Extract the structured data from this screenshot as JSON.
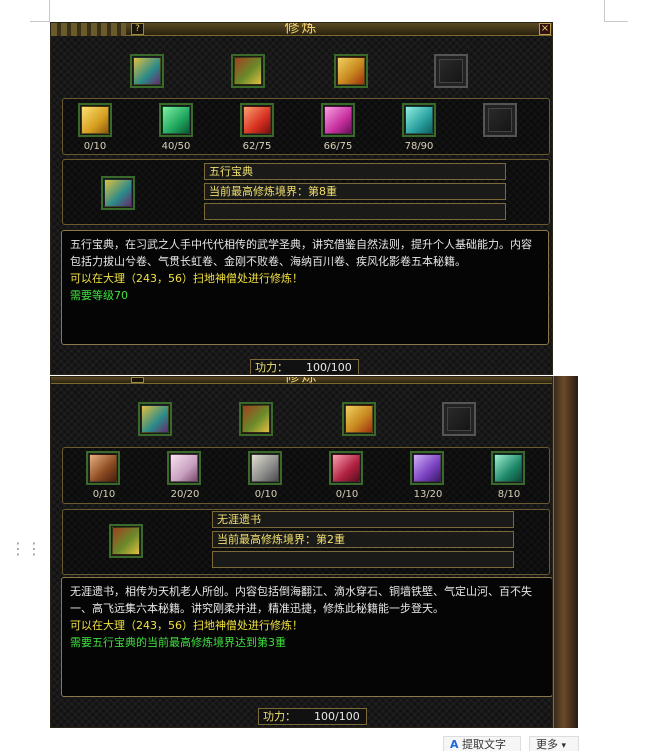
{
  "toolbar": {
    "extract_text_label": "提取文字",
    "more_label": "更多",
    "extract_icon": "text-extract-icon",
    "more_icon": "chevron-down-icon"
  },
  "panel1": {
    "title": "修炼",
    "help": "?",
    "close": "×",
    "top_books": [
      {
        "icon": "wuxing-book-icon",
        "color": "#2a8a8a"
      },
      {
        "icon": "wuya-book-icon",
        "color": "#6a8a2a"
      },
      {
        "icon": "gold-book-icon",
        "color": "#c88a20"
      },
      {
        "icon": "empty-slot-icon",
        "color": "#333333"
      }
    ],
    "sub_books": [
      {
        "icon": "gold-scroll-icon",
        "color": "#d8a020",
        "count": "0/10"
      },
      {
        "icon": "green-scroll-icon",
        "color": "#20a860",
        "count": "40/50"
      },
      {
        "icon": "red-scroll-icon",
        "color": "#d83020",
        "count": "62/75"
      },
      {
        "icon": "magenta-scroll-icon",
        "color": "#c830a0",
        "count": "66/75"
      },
      {
        "icon": "teal-scroll-icon",
        "color": "#2aa0a0",
        "count": "78/90"
      },
      {
        "icon": "empty-slot-icon",
        "color": "#333333",
        "count": ""
      }
    ],
    "selected_icon": "wuxing-book-icon",
    "name": "五行宝典",
    "realm": "当前最高修炼境界：第8重",
    "blank_field": "",
    "desc_main": "五行宝典，在习武之人手中代代相传的武学圣典，讲究借鉴自然法则，提升个人基础能力。内容包括力拔山兮卷、气贯长虹卷、金刚不败卷、海纳百川卷、疾风化影卷五本秘籍。",
    "desc_location": "可以在大理（243，56）扫地神僧处进行修炼！",
    "desc_req": "需要等级70",
    "gong_label": "功力：",
    "gong_value": "100/100"
  },
  "panel2": {
    "title": "修炼",
    "top_books": [
      {
        "icon": "wuxing-book-icon",
        "color": "#2a8a8a"
      },
      {
        "icon": "wuya-book-icon",
        "color": "#6a8a2a"
      },
      {
        "icon": "gold-book-icon",
        "color": "#c88a20"
      },
      {
        "icon": "empty-slot-icon",
        "color": "#333333"
      }
    ],
    "sub_books": [
      {
        "icon": "brown-scroll-icon",
        "color": "#8a4a20",
        "count": "0/10"
      },
      {
        "icon": "pink-scroll-icon",
        "color": "#c8a0c0",
        "count": "20/20"
      },
      {
        "icon": "grey-scroll-icon",
        "color": "#8a8a8a",
        "count": "0/10"
      },
      {
        "icon": "crimson-scroll-icon",
        "color": "#b02040",
        "count": "0/10"
      },
      {
        "icon": "purple-scroll-icon",
        "color": "#7a40c0",
        "count": "13/20"
      },
      {
        "icon": "jade-scroll-icon",
        "color": "#208a6a",
        "count": "8/10"
      }
    ],
    "selected_icon": "wuya-book-icon",
    "name": "无涯遗书",
    "realm": "当前最高修炼境界：第2重",
    "blank_field": "",
    "desc_main": "无涯遗书，相传为天机老人所创。内容包括倒海翻江、滴水穿石、铜墙铁壁、气定山河、百不失一、高飞远集六本秘籍。讲究刚柔并进，精准迅捷，修炼此秘籍能一步登天。",
    "desc_location": "可以在大理（243，56）扫地神僧处进行修炼！",
    "desc_req": "需要五行宝典的当前最高修炼境界达到第3重",
    "gong_label": "功力：",
    "gong_value": "100/100"
  }
}
